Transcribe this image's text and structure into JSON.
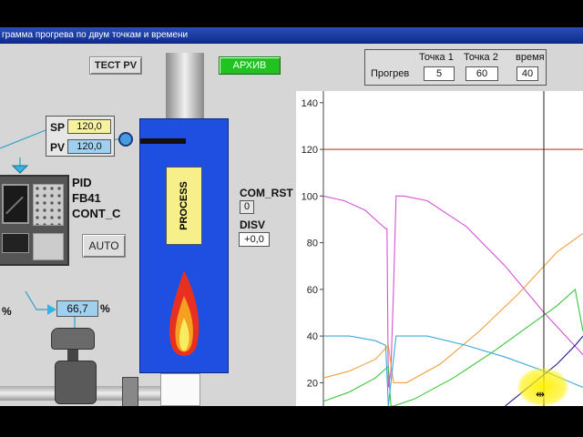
{
  "window": {
    "title": "грамма прогрева по двум точкам и времени"
  },
  "toolbar": {
    "test_pv_label": "ТЕСТ PV",
    "archive_label": "АРХИВ"
  },
  "points_table": {
    "headers": [
      "Точка 1",
      "Точка 2",
      "время"
    ],
    "row_label": "Прогрев",
    "values": [
      "5",
      "60",
      "40"
    ]
  },
  "controller": {
    "sp_label": "SP",
    "sp_value": "120,0",
    "pv_label": "PV",
    "pv_value": "120,0",
    "name_line1": "PID",
    "name_line2": "FB41",
    "name_line3": "CONT_C",
    "auto_label": "AUTO",
    "output_value": "66,7",
    "output_unit": "%",
    "left_unit": "%"
  },
  "process": {
    "label": "PROCESS"
  },
  "com_rst": {
    "label": "COM_RST",
    "value": "0"
  },
  "disv": {
    "label": "DISV",
    "value": "+0,0"
  },
  "colors": {
    "furnace_blue": "#1f4fe0",
    "process_yellow": "#f7ef8a",
    "archive_green": "#1fc41f",
    "series_magenta": "#d452d4",
    "series_orange": "#f0a040",
    "series_green": "#3cc43c",
    "series_cyan": "#40a8d8",
    "series_navy": "#1a1a8a",
    "setpoint_red": "#b84030"
  },
  "chart_data": {
    "type": "line",
    "yticks": [
      20,
      40,
      60,
      80,
      100,
      120,
      140
    ],
    "ylim": [
      10,
      145
    ],
    "xlim": [
      0,
      100
    ],
    "grid": false,
    "series": [
      {
        "color": "#b84030",
        "x": [
          0,
          100
        ],
        "y": [
          120,
          120
        ]
      },
      {
        "color": "#d452d4",
        "x": [
          0,
          8,
          16,
          22,
          24,
          24.5,
          25,
          26,
          27,
          28,
          31,
          40,
          55,
          70,
          85,
          100
        ],
        "y": [
          100,
          98,
          94,
          88,
          86,
          86,
          18,
          25,
          60,
          100,
          100,
          98,
          87,
          70,
          50,
          32
        ]
      },
      {
        "color": "#f0a040",
        "x": [
          0,
          10,
          20,
          25,
          27,
          32,
          45,
          60,
          75,
          90,
          100
        ],
        "y": [
          22,
          25,
          30,
          36,
          20,
          20,
          28,
          42,
          58,
          76,
          84
        ]
      },
      {
        "color": "#3cc43c",
        "x": [
          0,
          10,
          20,
          25,
          26,
          27,
          35,
          50,
          65,
          80,
          90,
          97,
          100
        ],
        "y": [
          12,
          16,
          22,
          27,
          10,
          10,
          13,
          22,
          33,
          45,
          53,
          60,
          42
        ]
      },
      {
        "color": "#40a8d8",
        "x": [
          0,
          10,
          20,
          24,
          25,
          26,
          28,
          40,
          55,
          70,
          85,
          100
        ],
        "y": [
          40,
          40,
          38,
          36,
          10,
          20,
          40,
          40,
          36,
          31,
          25,
          18
        ]
      },
      {
        "color": "#1a1a8a",
        "x": [
          70,
          80,
          90,
          97,
          100
        ],
        "y": [
          10,
          19,
          28,
          36,
          40
        ]
      }
    ]
  }
}
